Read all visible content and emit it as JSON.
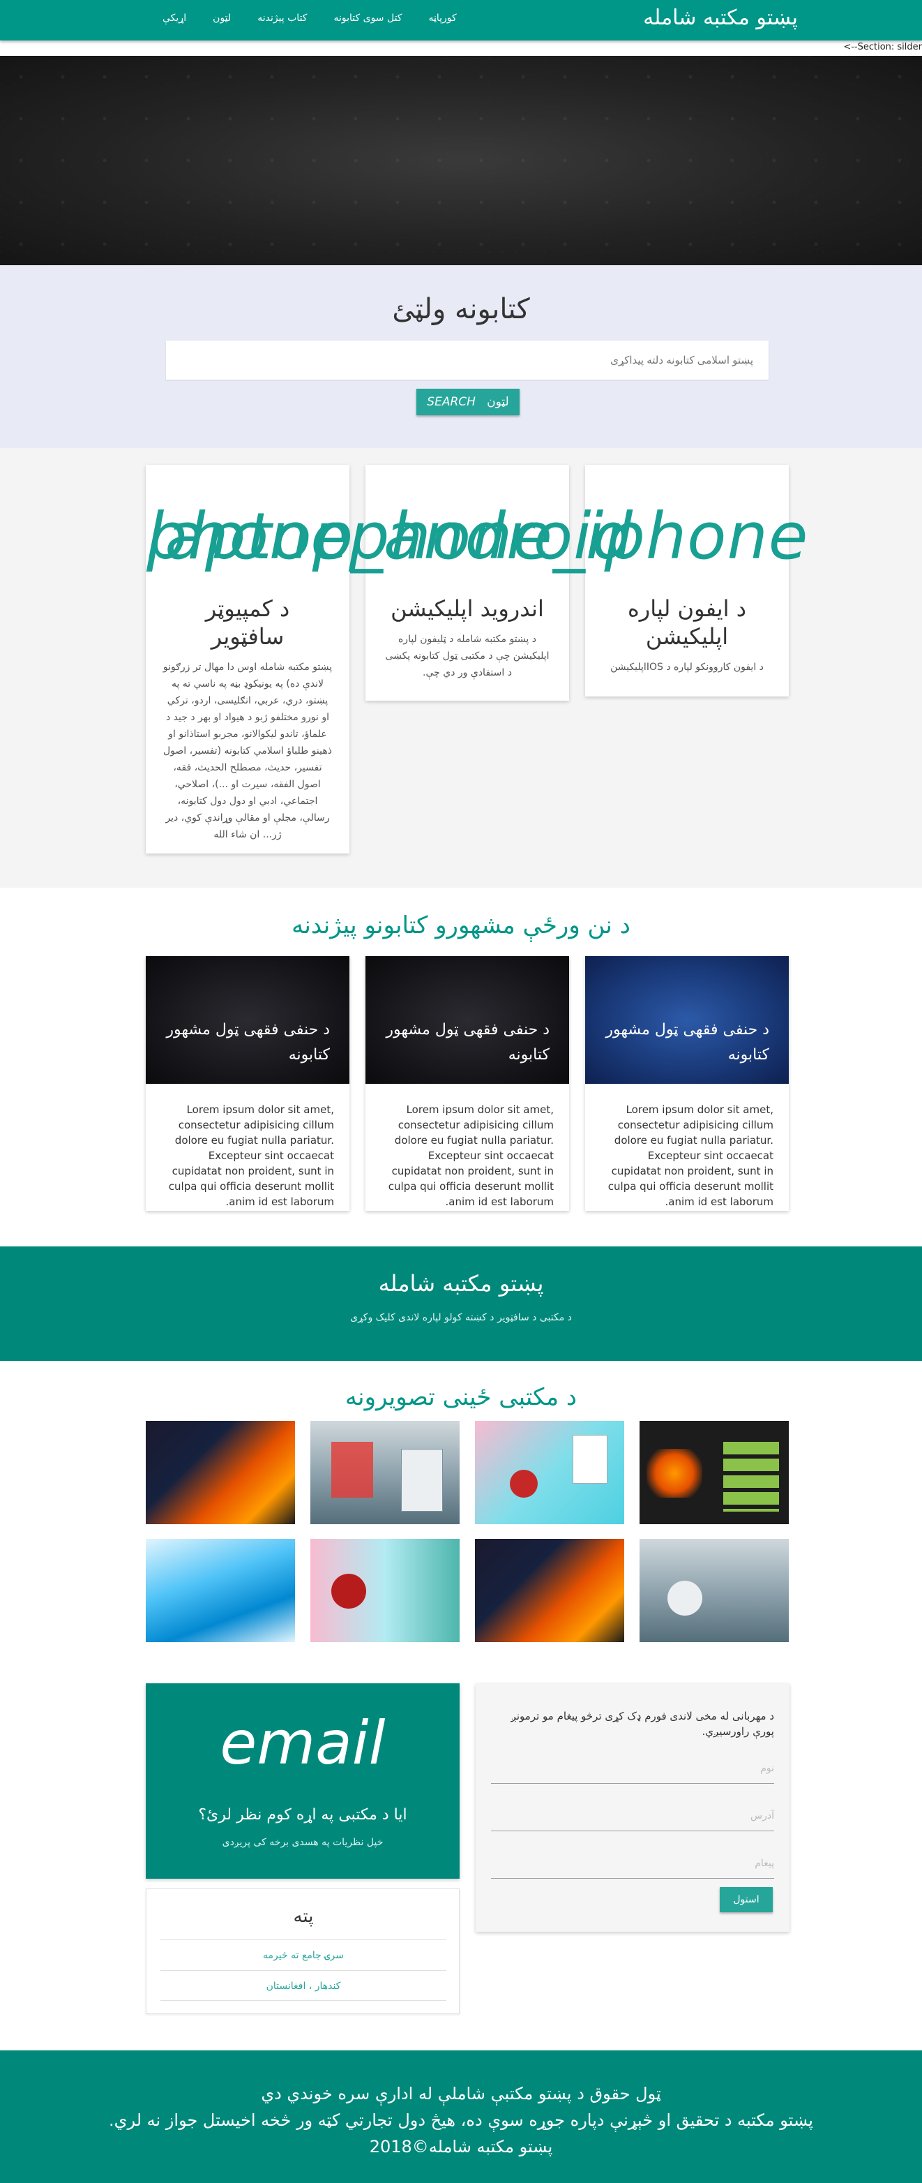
{
  "nav": {
    "brand": "پښتو مکتبه شامله",
    "links": [
      "کورپاڼه",
      "کتل سوی کتابونه",
      "کتاب پیژندنه",
      "لټون",
      "اړیکې"
    ]
  },
  "section_comment": "<--Section: silder",
  "search": {
    "title": "کتابونه ولټئ",
    "placeholder": "پښتو اسلامی کتابونه دلته پیداکړی",
    "button_label": "لټون",
    "button_latin": "SEARCH"
  },
  "apps": {
    "icon_texts": [
      "laptop",
      "phone_android",
      "phone_iphone"
    ],
    "cards": [
      {
        "icon": "laptop",
        "title": "د کمپیوټر سافټویر",
        "desc": "پښتو مکتبه شامله اوس دا مهال تر زرګونو لاندې ده) په یونیکوډ بڼه په ناسي ته په پښتو، دري، عربي، انګلیسی، اردو، ترکي او نورو مختلفو ژبو د هیواد او بهر د جید د علماؤ، تاندو لیکوالانو، مجربو استاذانو او ذهینو طلباؤ اسلامي کتابونه (تفسیر، اصول تفسیر، حدیث، مصطلح الحدیث، فقه، اصول الفقه، سیرت او ...)، اصلاحي، اجتماعي، ادبي او دول دول کتابونه، رسالې، مجلې او مقالې وړاندې کوي، دیر ژر... ان شاء الله"
      },
      {
        "icon": "phone_android",
        "title": "اندروید اپلیکیشن",
        "desc": "د پښتو مکتبه شامله د ټلیفون لپاره اپلیکیشن چې د مکتبی ټول کتابونه پکښی د استفادې ور دي چې."
      },
      {
        "icon": "phone_iphone",
        "title": "د ایفون لپاره اپلیکیشن",
        "desc": "د ایفون کاروونکو لپاره د IOSاپلیکیشن"
      }
    ]
  },
  "featured": {
    "heading": "د نن ورځې مشهورو کتابونو پیژندنه",
    "cards": [
      {
        "title": "د حنفی فقهی ټول مشهور کتابونه",
        "body": "Lorem ipsum dolor sit amet, consectetur adipisicing cillum dolore eu fugiat nulla pariatur. Excepteur sint occaecat cupidatat non proident, sunt in culpa qui officia deserunt mollit anim id est laborum."
      },
      {
        "title": "د حنفی فقهی ټول مشهور کتابونه",
        "body": "Lorem ipsum dolor sit amet, consectetur adipisicing cillum dolore eu fugiat nulla pariatur. Excepteur sint occaecat cupidatat non proident, sunt in culpa qui officia deserunt mollit anim id est laborum."
      },
      {
        "title": "د حنفی فقهی ټول مشهور کتابونه",
        "body": "Lorem ipsum dolor sit amet, consectetur adipisicing cillum dolore eu fugiat nulla pariatur. Excepteur sint occaecat cupidatat non proident, sunt in culpa qui officia deserunt mollit anim id est laborum."
      }
    ]
  },
  "banner": {
    "title": "پښتو مکتبه شامله",
    "subtitle": "د مکتبی د سافټویر د کښته کولو لپاره لاندی کلیک وکړی"
  },
  "gallery": {
    "heading": "د مکتبی ځینی تصویرونه"
  },
  "contact": {
    "intro": "د مهربانی له مخی لاندی فورم ډک کړی ترڅو پیغام مو ترمونږ پورې راورسیږي.",
    "name_placeholder": "نوم",
    "address_placeholder": "آدرس",
    "message_placeholder": "پیغام",
    "send_label": "استول"
  },
  "email_card": {
    "big": "email",
    "question": "ایا د مکتبی په اړه کوم نظر لرئ؟",
    "sub": "خپل نظریات په هسدی برخه کی پریږدی"
  },
  "address": {
    "heading": "پته",
    "rows": [
      "سرۍ جامع ته څیرمه",
      "کندهار ، افغانستان"
    ]
  },
  "footer": {
    "line1": "ټول حقوق د پښتو مکتبې شاملې له ادارې سره خوندي دي",
    "line2": "پښتو مکتبه د تحقیق او څېړنې دپاره جوړه سوې ده، هیڅ دول تجارتي کټه ور څخه اخیستل جواز نه لري.",
    "line3": "پښتو مکتبه شامله©2018"
  },
  "colors": {
    "primary": "#009688",
    "primary_dark": "#00897b",
    "accent": "#26a69a",
    "search_bg": "#e8eaf6"
  }
}
